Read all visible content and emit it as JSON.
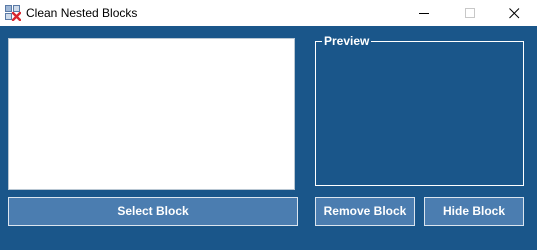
{
  "window": {
    "title": "Clean Nested Blocks",
    "icon": "app-blocks-icon",
    "controls": {
      "minimize_icon": "minimize-icon",
      "maximize_icon": "maximize-icon",
      "close_icon": "close-icon"
    }
  },
  "main": {
    "list_items": [],
    "preview": {
      "label": "Preview"
    },
    "buttons": {
      "select_label": "Select Block",
      "remove_label": "Remove Block",
      "hide_label": "Hide Block"
    }
  },
  "colors": {
    "client_background": "#1a568a",
    "button_background": "#4b7db0",
    "button_text": "#ffffff",
    "list_background": "#ffffff"
  }
}
